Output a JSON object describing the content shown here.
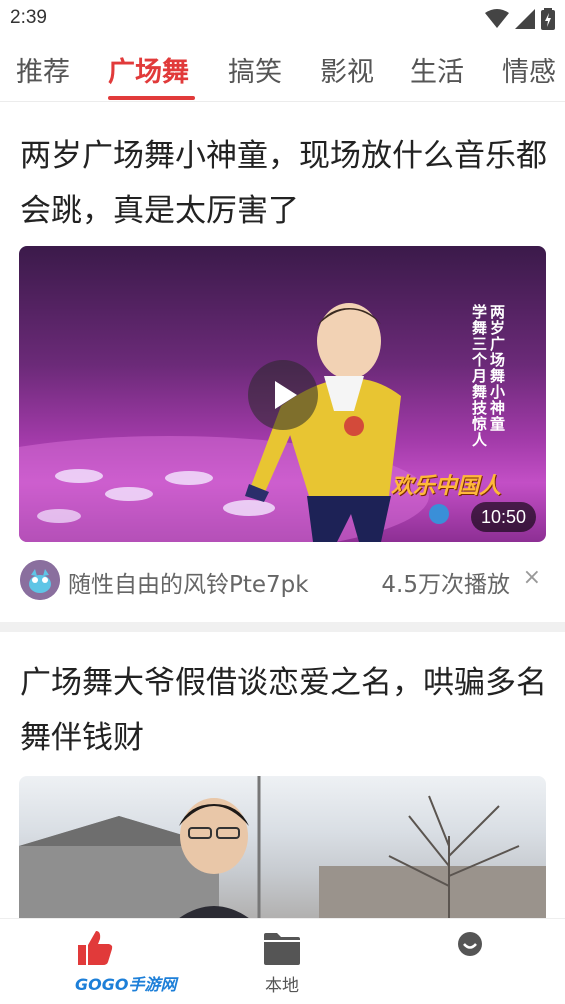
{
  "status": {
    "time": "2:39"
  },
  "tabs": [
    "推荐",
    "广场舞",
    "搞笑",
    "影视",
    "生活",
    "情感"
  ],
  "cards": [
    {
      "title": "两岁广场舞小神童，现场放什么音乐都会跳，真是太厉害了",
      "duration": "10:50",
      "overlay_text_a": "两岁广场舞小神童",
      "overlay_text_b": "学舞三个月舞技惊人",
      "overlay_brand": "欢乐中国人",
      "author": "随性自由的风铃Pte7pk",
      "plays": "4.5万次播放",
      "close": "×"
    },
    {
      "title": "广场舞大爷假借谈恋爱之名，哄骗多名舞伴钱财"
    }
  ],
  "bottom_nav": {
    "local_label": "本地",
    "watermark": "GOGO手游网"
  },
  "colors": {
    "accent": "#e13a3a",
    "nav_blue": "#1d7fd8"
  }
}
